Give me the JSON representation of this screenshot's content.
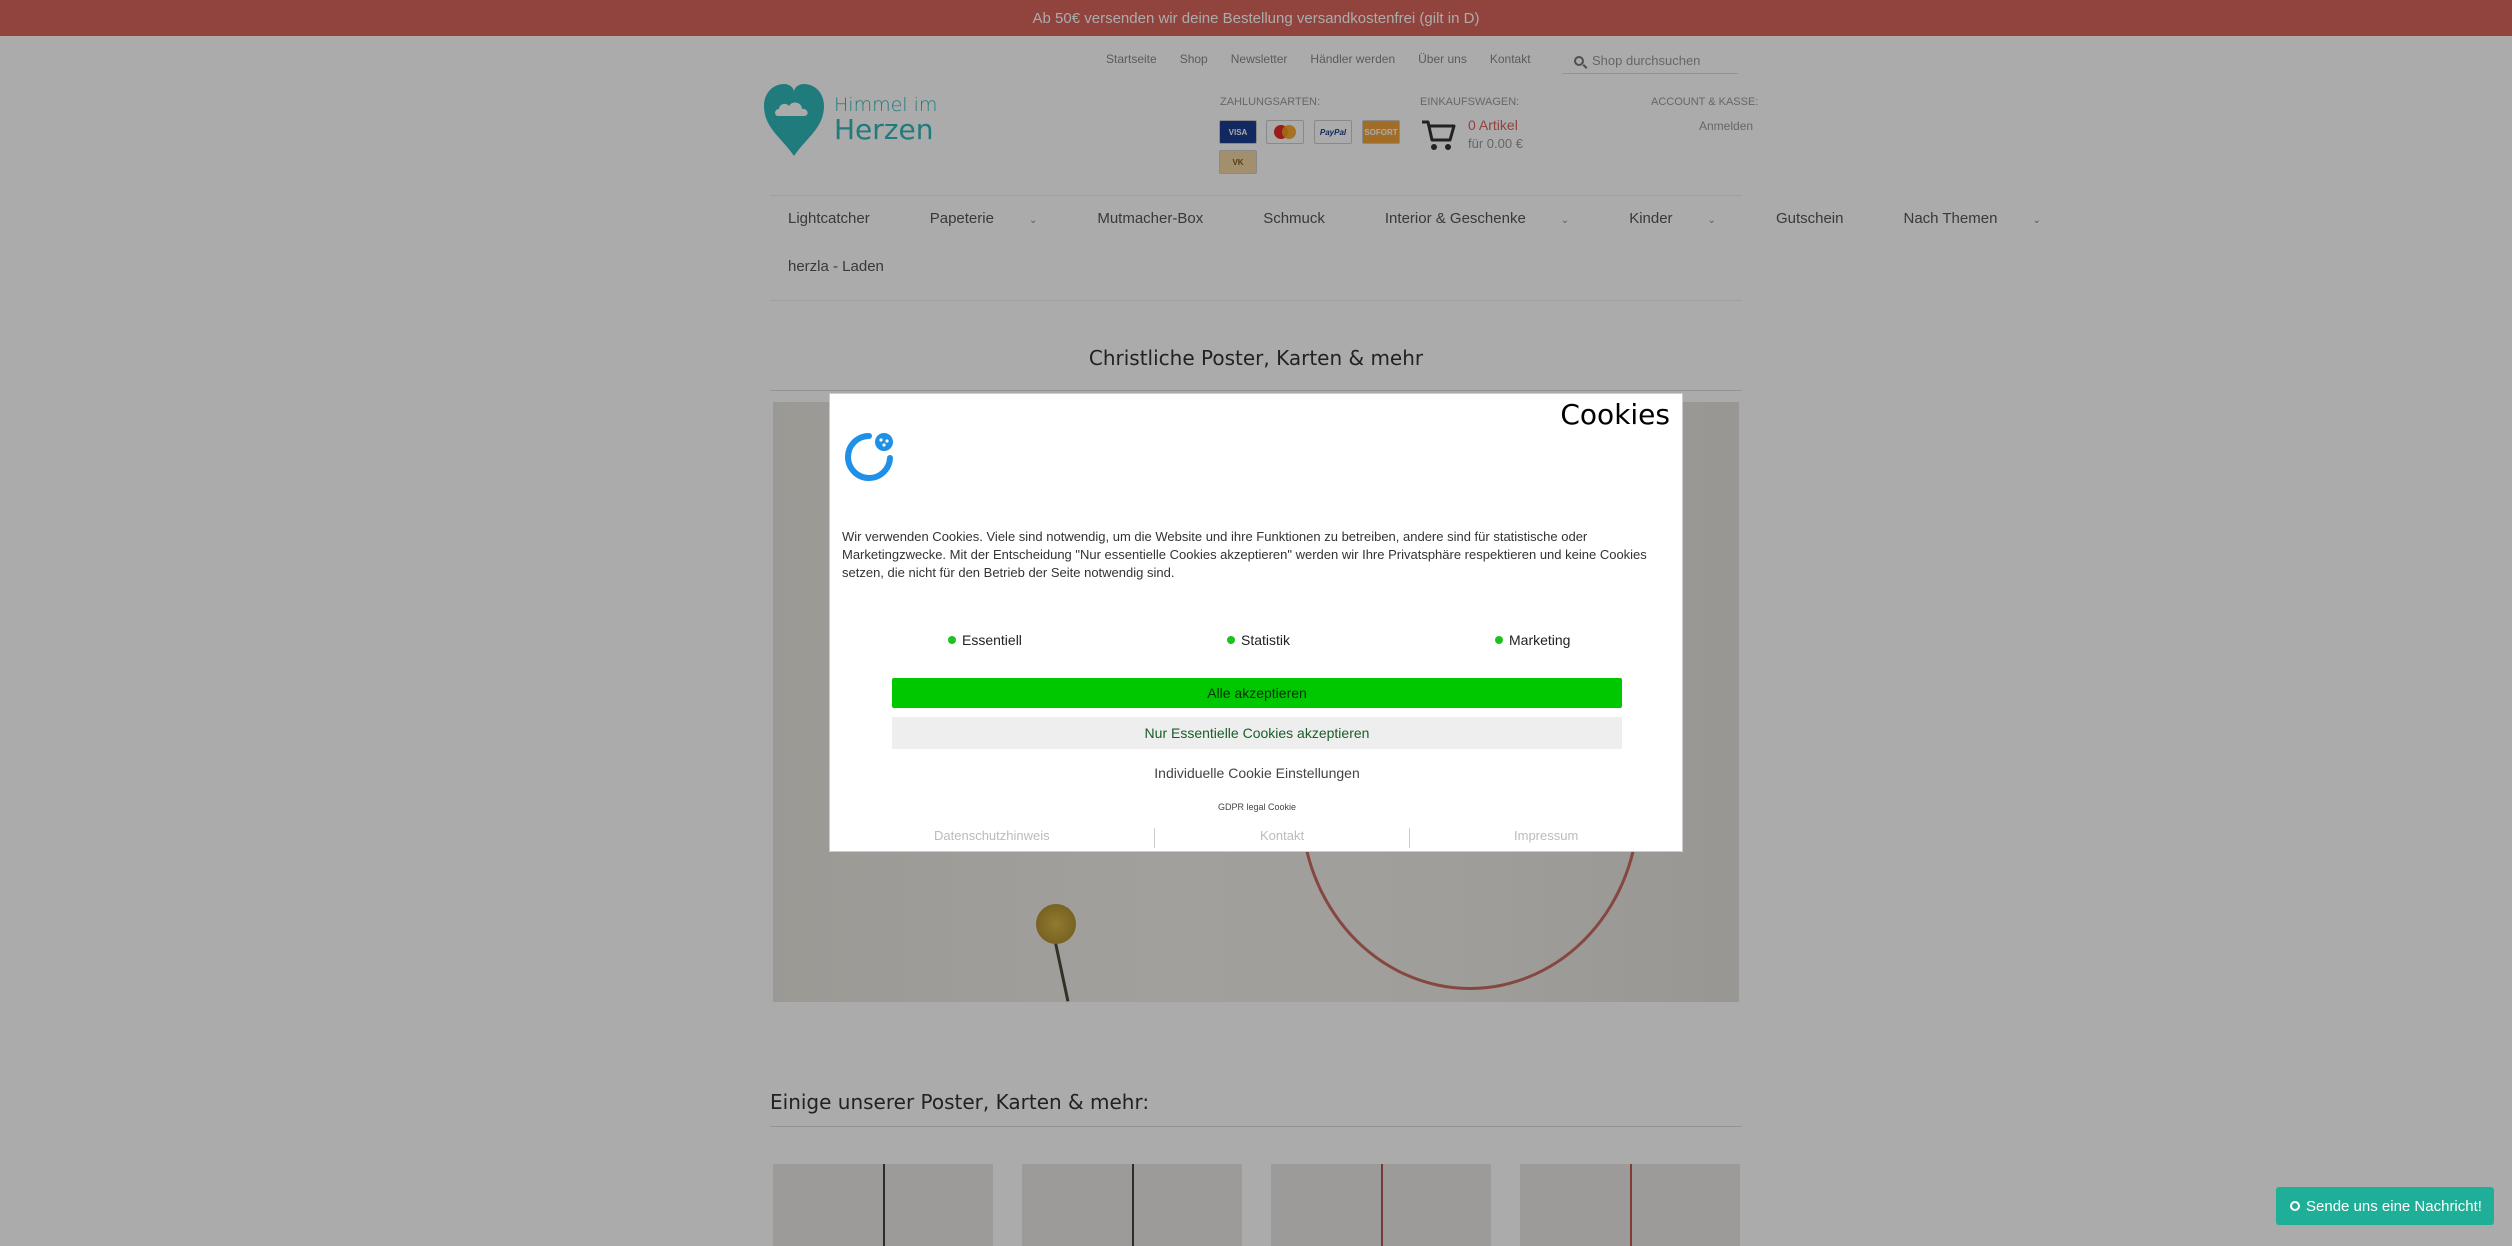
{
  "banner": {
    "text": "Ab 50€ versenden wir deine Bestellung versandkostenfrei (gilt in D)"
  },
  "topnav": [
    "Startseite",
    "Shop",
    "Newsletter",
    "Händler werden",
    "Über uns",
    "Kontakt"
  ],
  "search": {
    "placeholder": "Shop durchsuchen"
  },
  "logo": {
    "line1": "Himmel im",
    "line2": "Herzen"
  },
  "header": {
    "payment_label": "ZAHLUNGSARTEN:",
    "payment_methods": [
      "VISA",
      "MasterCard",
      "PayPal",
      "Sofort",
      "Vorkasse"
    ],
    "cart_label": "EINKAUFSWAGEN:",
    "cart_items": "0 Artikel",
    "cart_sum": "für 0.00 €",
    "account_label": "ACCOUNT & KASSE:",
    "login": "Anmelden"
  },
  "mainnav": [
    {
      "label": "Lightcatcher"
    },
    {
      "label": "Papeterie",
      "dropdown": true
    },
    {
      "label": "Mutmacher-Box"
    },
    {
      "label": "Schmuck"
    },
    {
      "label": "Interior & Geschenke",
      "dropdown": true
    },
    {
      "label": "Kinder",
      "dropdown": true
    },
    {
      "label": "Gutschein"
    },
    {
      "label": "Nach Themen",
      "dropdown": true
    }
  ],
  "mainnav2": {
    "label": "herzla - Laden"
  },
  "page": {
    "title": "Christliche Poster, Karten & mehr",
    "subtitle": "Einige unserer Poster, Karten & mehr:"
  },
  "cookie_modal": {
    "title": "Cookies",
    "text": "Wir verwenden Cookies. Viele sind notwendig, um die Website und ihre Funktionen zu betreiben, andere sind für statistische oder Marketingzwecke. Mit der Entscheidung \"Nur essentielle Cookies akzeptieren\" werden wir Ihre Privatsphäre respektieren und keine Cookies setzen, die nicht für den Betrieb der Seite notwendig sind.",
    "options": [
      "Essentiell",
      "Statistik",
      "Marketing"
    ],
    "accept_all": "Alle akzeptieren",
    "accept_essential": "Nur Essentielle Cookies akzeptieren",
    "individual": "Individuelle Cookie Einstellungen",
    "gdpr": "GDPR legal Cookie",
    "links": [
      "Datenschutzhinweis",
      "Kontakt",
      "Impressum"
    ],
    "accent_color": "#00c800"
  },
  "chat": {
    "label": "Sende uns eine Nachricht!",
    "color": "#1fae97"
  }
}
